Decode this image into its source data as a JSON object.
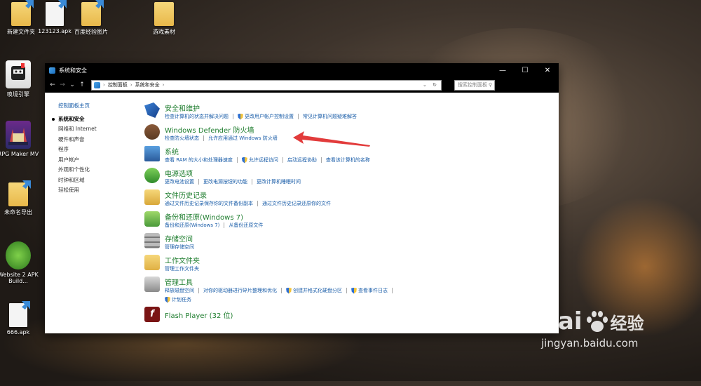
{
  "desktop": {
    "icons": [
      {
        "label": "新建文件夹"
      },
      {
        "label": "123123.apk"
      },
      {
        "label": "百度经验图片"
      },
      {
        "label": "游戏素材"
      },
      {
        "label": "唤境引擎"
      },
      {
        "label": "RPG Maker MV"
      },
      {
        "label": "未命名导出"
      },
      {
        "label": "Website 2 APK Build..."
      },
      {
        "label": "666.apk"
      }
    ]
  },
  "window": {
    "title": "系统和安全",
    "buttons": {
      "minimize": "—",
      "maximize": "☐",
      "close": "✕"
    },
    "address": {
      "crumbs": [
        "控制面板",
        "系统和安全"
      ],
      "search_placeholder": "搜索控制面板"
    }
  },
  "sidebar": {
    "home": "控制面板主页",
    "items": [
      "系统和安全",
      "网络和 Internet",
      "硬件和声音",
      "程序",
      "用户帐户",
      "外观和个性化",
      "时钟和区域",
      "轻松使用"
    ]
  },
  "categories": [
    {
      "title": "安全和维护",
      "links": [
        "检查计算机的状态并解决问题",
        "更改用户帐户控制设置",
        "常见计算机问题疑难解答"
      ]
    },
    {
      "title": "Windows Defender 防火墙",
      "links": [
        "检查防火墙状态",
        "允许应用通过 Windows 防火墙"
      ]
    },
    {
      "title": "系统",
      "links": [
        "查看 RAM 的大小和处理器速度",
        "允许远程访问",
        "启动远程协助",
        "查看该计算机的名称"
      ]
    },
    {
      "title": "电源选项",
      "links": [
        "更改电池设置",
        "更改电源按钮的功能",
        "更改计算机睡眠时间"
      ]
    },
    {
      "title": "文件历史记录",
      "links": [
        "通过文件历史记录保存你的文件备份副本",
        "通过文件历史记录还原你的文件"
      ]
    },
    {
      "title": "备份和还原(Windows 7)",
      "links": [
        "备份和还原(Windows 7)",
        "从备份还原文件"
      ]
    },
    {
      "title": "存储空间",
      "links": [
        "管理存储空间"
      ]
    },
    {
      "title": "工作文件夹",
      "links": [
        "管理工作文件夹"
      ]
    },
    {
      "title": "管理工具",
      "links": [
        "释放磁盘空间",
        "对你的驱动器进行碎片整理和优化",
        "创建并格式化硬盘分区",
        "查看事件日志",
        "计划任务"
      ]
    },
    {
      "title": "Flash Player (32 位)",
      "links": []
    }
  ],
  "watermark": {
    "brand": "Bai",
    "brand_suffix": "经验",
    "url": "jingyan.baidu.com"
  },
  "colors": {
    "link": "#1a5da8",
    "category_title": "#1e7d2e",
    "annotation_arrow": "#e23b3b"
  }
}
